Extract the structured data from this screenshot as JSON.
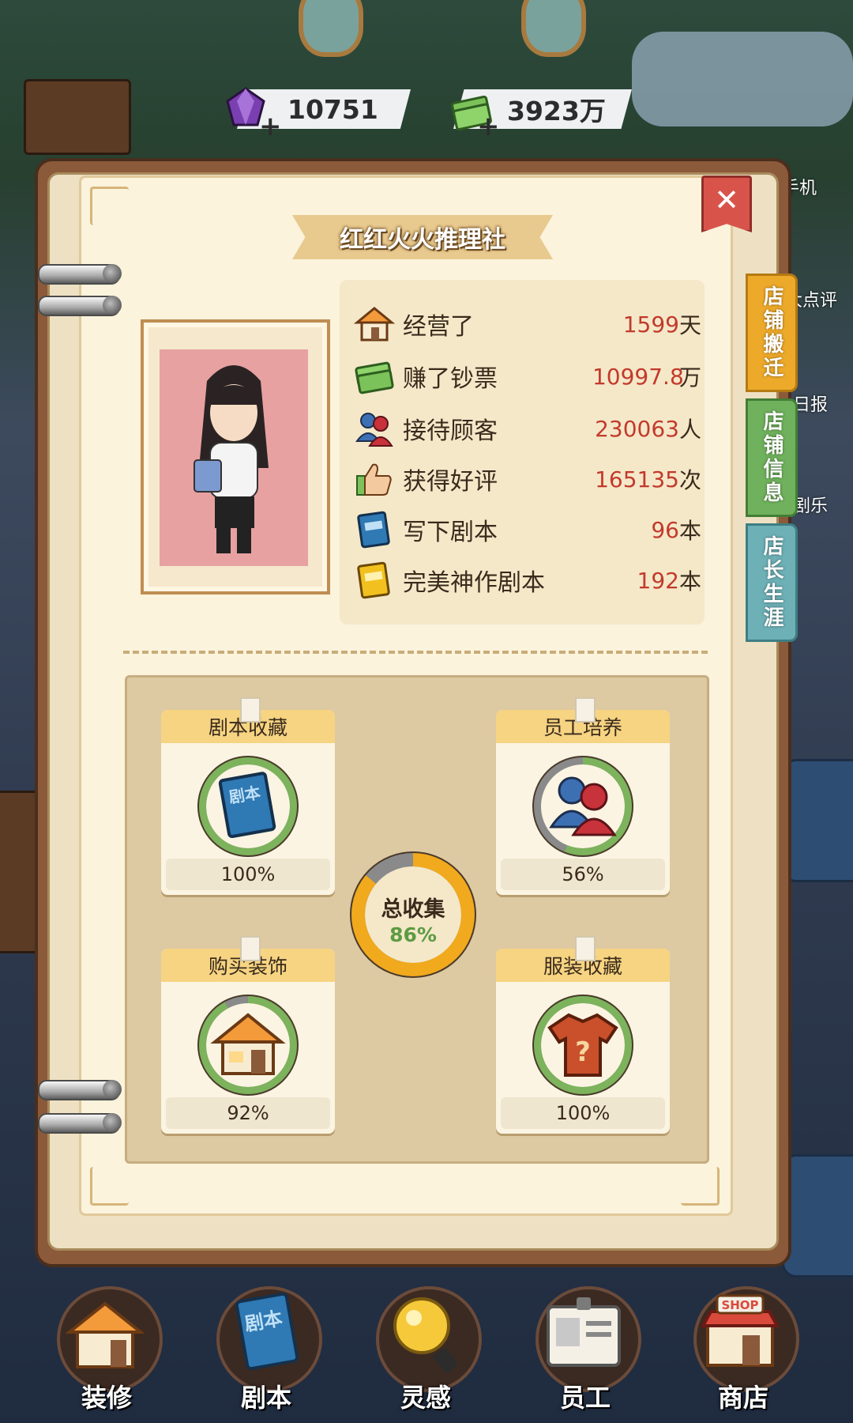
{
  "currency": {
    "gems": "10751",
    "cash": "3923万"
  },
  "background_labels": {
    "phone": "手机",
    "review": "大点评",
    "daily": "日报",
    "fun": "剧乐"
  },
  "card": {
    "title": "红红火火推理社",
    "close_symbol": "✕"
  },
  "side_tabs": [
    "店铺搬迁",
    "店铺信息",
    "店长生涯"
  ],
  "stats": [
    {
      "label": "经营了",
      "value": "1599",
      "unit": "天",
      "icon": "house-icon"
    },
    {
      "label": "赚了钞票",
      "value": "10997.8",
      "unit": "万",
      "icon": "cash-icon"
    },
    {
      "label": "接待顾客",
      "value": "230063",
      "unit": "人",
      "icon": "customers-icon"
    },
    {
      "label": "获得好评",
      "value": "165135",
      "unit": "次",
      "icon": "thumbs-up-icon"
    },
    {
      "label": "写下剧本",
      "value": "96",
      "unit": "本",
      "icon": "script-book-icon"
    },
    {
      "label": "完美神作剧本",
      "value": "192",
      "unit": "本",
      "icon": "gold-script-icon"
    }
  ],
  "collections": [
    {
      "title": "剧本收藏",
      "percent": "100%",
      "progress": 1.0,
      "icon": "script-book-icon",
      "book_text": "剧本"
    },
    {
      "title": "员工培养",
      "percent": "56%",
      "progress": 0.56,
      "icon": "staff-icon"
    },
    {
      "title": "购买装饰",
      "percent": "92%",
      "progress": 0.92,
      "icon": "house-icon"
    },
    {
      "title": "服装收藏",
      "percent": "100%",
      "progress": 1.0,
      "icon": "shirt-icon"
    }
  ],
  "total": {
    "label": "总收集",
    "percent": "86%",
    "progress": 0.86
  },
  "nav": [
    {
      "label": "装修",
      "icon": "decorate-icon"
    },
    {
      "label": "剧本",
      "icon": "script-icon",
      "badge_text": "剧本"
    },
    {
      "label": "灵感",
      "icon": "inspiration-icon"
    },
    {
      "label": "员工",
      "icon": "staff-badge-icon"
    },
    {
      "label": "商店",
      "icon": "shop-icon",
      "badge_text": "SHOP"
    }
  ],
  "colors": {
    "ring_green": "#7cb35c",
    "ring_gray": "#8a8a8a",
    "ring_orange": "#f1a91d",
    "value_red": "#c33a2c"
  }
}
